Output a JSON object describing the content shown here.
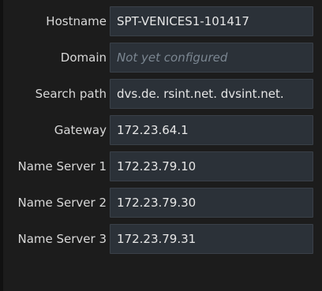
{
  "network_settings": {
    "fields": [
      {
        "label": "Hostname",
        "value": "SPT-VENICES1-101417",
        "placeholder": ""
      },
      {
        "label": "Domain",
        "value": "",
        "placeholder": "Not yet configured"
      },
      {
        "label": "Search path",
        "value": "dvs.de. rsint.net. dvsint.net.",
        "placeholder": ""
      },
      {
        "label": "Gateway",
        "value": "172.23.64.1",
        "placeholder": ""
      },
      {
        "label": "Name Server 1",
        "value": "172.23.79.10",
        "placeholder": ""
      },
      {
        "label": "Name Server 2",
        "value": "172.23.79.30",
        "placeholder": ""
      },
      {
        "label": "Name Server 3",
        "value": "172.23.79.31",
        "placeholder": ""
      }
    ]
  },
  "colors": {
    "background": "#1c1c1c",
    "field_background": "#2b3138",
    "label_text": "#d8d8d8",
    "placeholder_text": "#7b8691"
  }
}
